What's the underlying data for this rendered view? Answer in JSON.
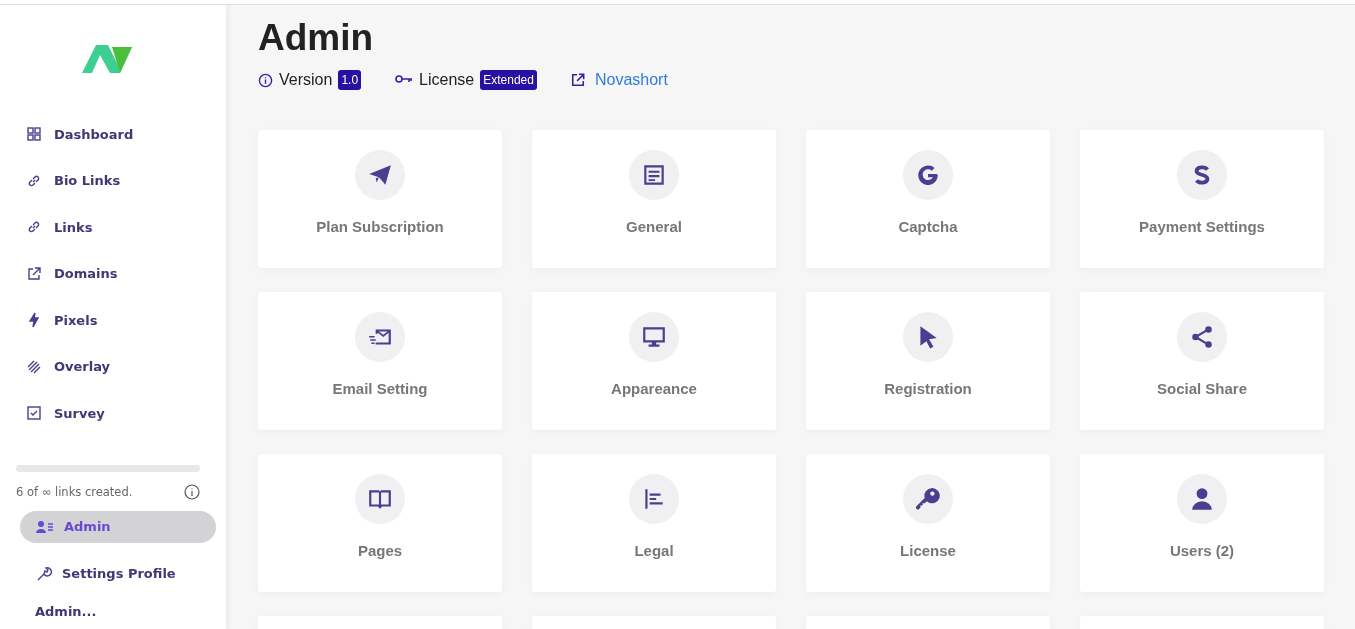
{
  "sidebar": {
    "nav": [
      {
        "label": "Dashboard",
        "selected": false
      },
      {
        "label": "Bio Links",
        "selected": false
      },
      {
        "label": "Links",
        "selected": false
      },
      {
        "label": "Domains",
        "selected": false
      },
      {
        "label": "Pixels",
        "selected": false
      },
      {
        "label": "Overlay",
        "selected": false
      },
      {
        "label": "Survey",
        "selected": false
      }
    ],
    "usage": {
      "text": "6 of ∞ links created."
    },
    "admin_nav": [
      {
        "label": "Admin",
        "selected": true
      },
      {
        "label": "Settings Profile",
        "selected": false
      }
    ],
    "section_heading": "Admin..."
  },
  "page": {
    "title": "Admin",
    "version_label": "Version",
    "version": "1.0",
    "license_label": "License",
    "license": "Extended",
    "link": "Novashort"
  },
  "cards": [
    {
      "label": "Plan Subscription"
    },
    {
      "label": "General"
    },
    {
      "label": "Captcha"
    },
    {
      "label": "Payment Settings"
    },
    {
      "label": "Email Setting"
    },
    {
      "label": "Appareance"
    },
    {
      "label": "Registration"
    },
    {
      "label": "Social Share"
    },
    {
      "label": "Pages"
    },
    {
      "label": "Legal"
    },
    {
      "label": "License"
    },
    {
      "label": "Users (2)"
    }
  ]
}
